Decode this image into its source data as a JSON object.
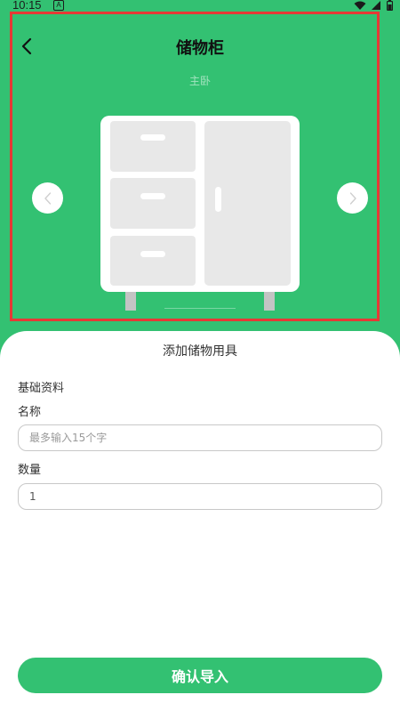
{
  "status_bar": {
    "time": "10:15",
    "notification_glyph": "A",
    "icons": [
      "wifi-icon",
      "cell-signal-icon",
      "battery-icon"
    ]
  },
  "header": {
    "title": "储物柜",
    "room": "主卧",
    "back_icon": "chevron-left-icon"
  },
  "carousel": {
    "prev_icon": "chevron-left-icon",
    "next_icon": "chevron-right-icon",
    "illustration": "cabinet-illustration"
  },
  "sheet": {
    "title": "添加储物用具",
    "section": "基础资料",
    "name_label": "名称",
    "name_placeholder": "最多输入15个字",
    "name_value": "",
    "quantity_label": "数量",
    "quantity_value": "1",
    "confirm_label": "确认导入"
  },
  "colors": {
    "accent": "#33c172",
    "highlight": "#e53935",
    "sheet_bg": "#ffffff"
  }
}
